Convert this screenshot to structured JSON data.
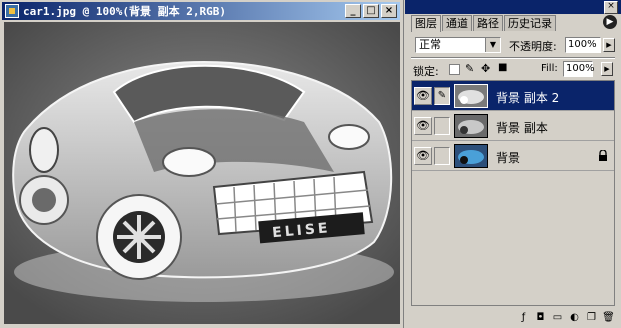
{
  "document_window": {
    "title": "car1.jpg @ 100%(背景 副本 2,RGB)",
    "buttons": {
      "minimize": "_",
      "maximize": "□",
      "close": "×"
    },
    "image_text": "ELISE"
  },
  "layers_panel": {
    "tabs": [
      "图层",
      "通道",
      "路径",
      "历史记录"
    ],
    "active_tab": 0,
    "blend_mode": "正常",
    "opacity_label": "不透明度:",
    "opacity_value": "100%",
    "lock_label": "锁定:",
    "fill_label": "Fill:",
    "fill_value": "100%",
    "layers": [
      {
        "name": "背景 副本 2",
        "selected": true,
        "visible": true,
        "locked": false
      },
      {
        "name": "背景 副本",
        "selected": false,
        "visible": true,
        "locked": false
      },
      {
        "name": "背景",
        "selected": false,
        "visible": true,
        "locked": true
      }
    ],
    "bottom_icons": [
      "layer-style-icon",
      "mask-icon",
      "new-set-icon",
      "adjustment-layer-icon",
      "new-layer-icon",
      "delete-layer-icon"
    ]
  },
  "colors": {
    "title_bar": "#0a246a",
    "selected_layer": "#0a246a",
    "chrome": "#d4d0c8"
  }
}
